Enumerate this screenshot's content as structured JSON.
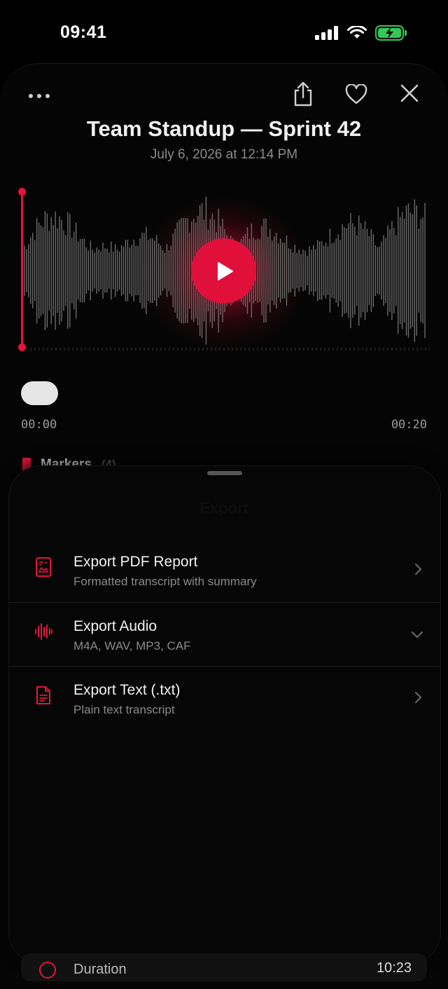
{
  "status_bar": {
    "time": "09:41",
    "icons": [
      "signal-icon",
      "wifi-icon",
      "battery-charging-icon"
    ],
    "battery_color": "#34c759"
  },
  "header": {
    "title": "Team Standup — Sprint 42",
    "subtitle": "July 6, 2026 at 12:14 PM",
    "icons": [
      "more-icon",
      "share-icon",
      "heart-icon",
      "close-icon"
    ]
  },
  "player": {
    "start_time": "00:00",
    "end_time": "00:20",
    "accent_color": "#e5143a"
  },
  "markers": {
    "label": "Markers",
    "count": "(4)"
  },
  "sheet": {
    "title": "Export",
    "items": [
      {
        "title": "Export PDF Report",
        "subtitle": "Formatted transcript with summary",
        "icon": "pdf-report-icon",
        "chevron": "chevron-right-icon"
      },
      {
        "title": "Export Audio",
        "subtitle": "M4A, WAV, MP3, CAF",
        "icon": "waveform-icon",
        "chevron": "chevron-down-icon"
      },
      {
        "title": "Export Text (.txt)",
        "subtitle": "Plain text transcript",
        "icon": "text-document-icon",
        "chevron": "chevron-right-icon"
      }
    ]
  },
  "details_peek": {
    "label": "Duration",
    "value": "10:23",
    "icon": "clock-icon"
  }
}
